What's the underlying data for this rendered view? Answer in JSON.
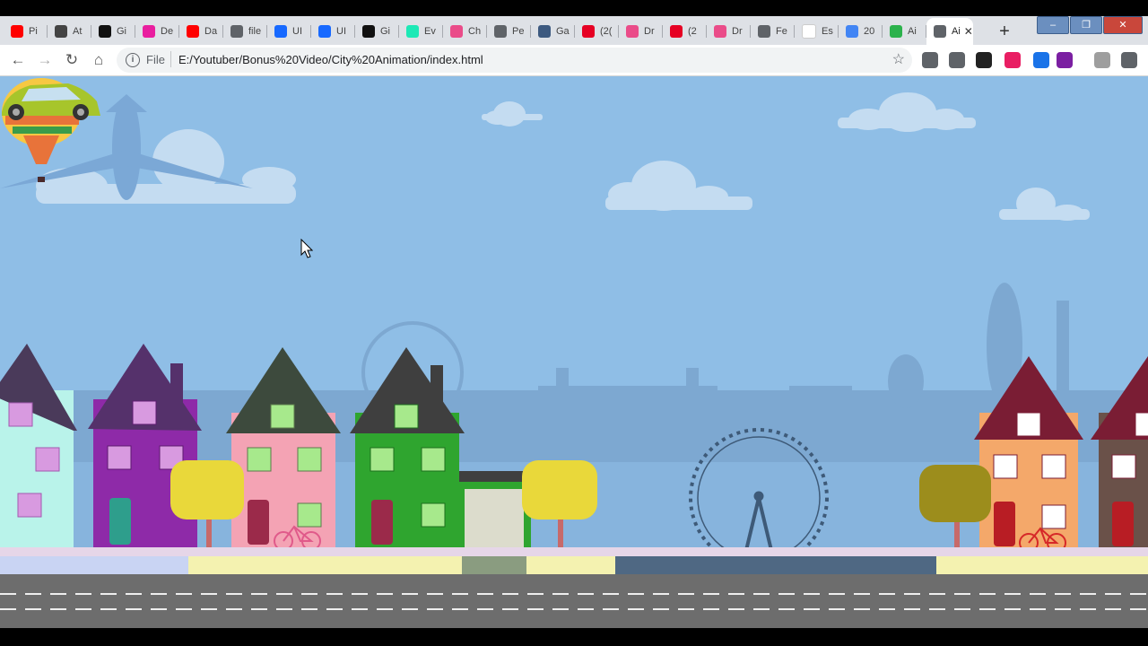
{
  "browser": {
    "tabs": [
      {
        "label": "Pi",
        "favicon": "youtube-icon",
        "color": "#ff0000"
      },
      {
        "label": "At",
        "favicon": "floppy-icon",
        "color": "#444444"
      },
      {
        "label": "Gi",
        "favicon": "github-icon",
        "color": "#111111"
      },
      {
        "label": "De",
        "favicon": "dribbble-icon",
        "color": "#e91e9f"
      },
      {
        "label": "Da",
        "favicon": "youtube-icon",
        "color": "#ff0000"
      },
      {
        "label": "file",
        "favicon": "globe-icon",
        "color": "#5f6368"
      },
      {
        "label": "UI",
        "favicon": "behance-icon",
        "color": "#1769ff"
      },
      {
        "label": "UI",
        "favicon": "behance-icon",
        "color": "#1769ff"
      },
      {
        "label": "Gi",
        "favicon": "github-icon",
        "color": "#111111"
      },
      {
        "label": "Ev",
        "favicon": "square-icon",
        "color": "#1de9b6"
      },
      {
        "label": "Ch",
        "favicon": "dribbble-icon",
        "color": "#ea4c89"
      },
      {
        "label": "Pe",
        "favicon": "globe-icon",
        "color": "#5f6368"
      },
      {
        "label": "Ga",
        "favicon": "building-icon",
        "color": "#3d5a80"
      },
      {
        "label": "(2(",
        "favicon": "pinterest-icon",
        "color": "#e60023"
      },
      {
        "label": "Dr",
        "favicon": "dribbble-icon",
        "color": "#ea4c89"
      },
      {
        "label": "(2",
        "favicon": "pinterest-icon",
        "color": "#e60023"
      },
      {
        "label": "Dr",
        "favicon": "dribbble-icon",
        "color": "#ea4c89"
      },
      {
        "label": "Fe",
        "favicon": "globe-icon",
        "color": "#5f6368"
      },
      {
        "label": "Es",
        "favicon": "blank-icon",
        "color": "#ffffff"
      },
      {
        "label": "20",
        "favicon": "page-icon",
        "color": "#4285f4"
      },
      {
        "label": "Ai",
        "favicon": "px-icon",
        "color": "#2bb24c"
      },
      {
        "label": "Ai",
        "favicon": "globe-icon",
        "color": "#5f6368",
        "active": true
      }
    ],
    "new_tab_symbol": "+",
    "window_controls": {
      "minimize": "–",
      "maximize": "❐",
      "close": "✕"
    },
    "nav": {
      "back": "←",
      "forward": "→",
      "reload": "↻",
      "home": "⌂"
    },
    "address": {
      "info_symbol": "i",
      "scheme_label": "File",
      "url": "E:/Youtuber/Bonus%20Video/City%20Animation/index.html",
      "bookmark_symbol": "☆"
    },
    "extensions": [
      {
        "name": "camera-icon",
        "color": "#5f6368"
      },
      {
        "name": "cast-icon",
        "color": "#5f6368"
      },
      {
        "name": "dark-reader-icon",
        "color": "#222222"
      },
      {
        "name": "notes-badge-icon",
        "color": "#e91e63"
      },
      {
        "name": "color-picker-icon",
        "color": "#1a73e8"
      },
      {
        "name": "moon-icon",
        "color": "#7b1fa2"
      },
      {
        "name": "profile-avatar-icon",
        "color": "#9e9e9e"
      },
      {
        "name": "menu-icon",
        "color": "#5f6368"
      }
    ]
  },
  "scene": {
    "sky_color": "#8fbee6",
    "skyline_color": "#7da8d1",
    "water_color": "#87b4dd",
    "road_color": "#6d6d6d",
    "sidewalk_color": "#f4f2b0",
    "houses": [
      {
        "name": "house-mint",
        "body": "#b9f3ea",
        "roof": "#4a3a5a"
      },
      {
        "name": "house-purple",
        "body": "#8e2aa8",
        "roof": "#55316b"
      },
      {
        "name": "house-pink",
        "body": "#f4a3b4",
        "roof": "#3d4a3d"
      },
      {
        "name": "house-green",
        "body": "#2fa52f",
        "roof": "#3f3f3f"
      },
      {
        "name": "house-orange",
        "body": "#f4a86a",
        "roof": "#7a1d34"
      },
      {
        "name": "house-brown",
        "body": "#6a5149",
        "roof": "#7a1d34"
      }
    ],
    "tree_color": "#e9d83a",
    "tree_color_dark": "#9c8d1c",
    "car_color": "#a7c52b",
    "balloon_colors": [
      "#f7c843",
      "#e8733a",
      "#3a9c4a"
    ]
  }
}
